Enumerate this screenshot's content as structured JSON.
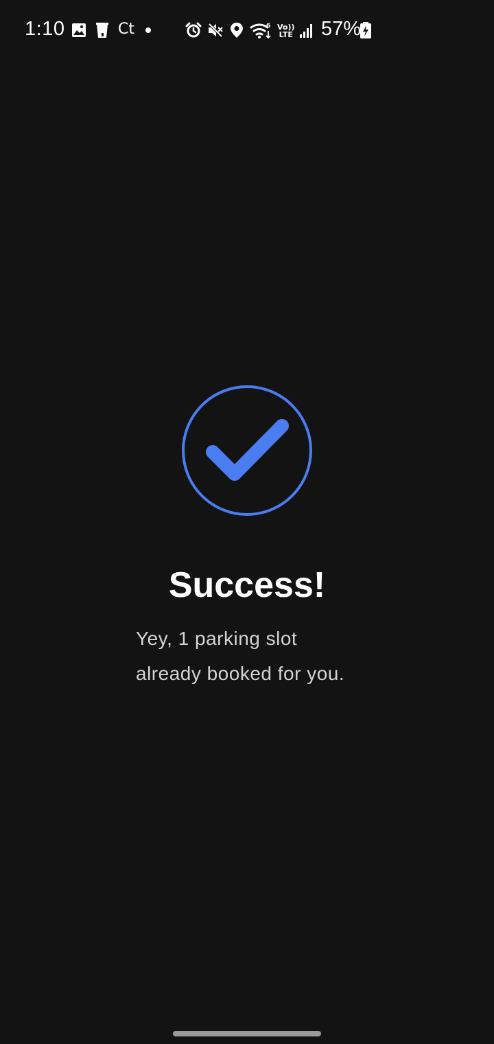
{
  "status_bar": {
    "time": "1:10",
    "carrier_icon_text": "Ct",
    "volte_line1": "Vo))",
    "volte_line2": "LTE",
    "battery_percent": "57%",
    "icons": [
      "gallery-icon",
      "cup-icon",
      "ct-icon",
      "dot-icon",
      "alarm-icon",
      "mute-icon",
      "location-icon",
      "wifi-icon",
      "volte-icon",
      "signal-icon",
      "battery-icon"
    ]
  },
  "success": {
    "title": "Success!",
    "message_line1": "Yey, 1 parking slot",
    "message_line2": "already booked for you.",
    "accent_color": "#4A7CF2"
  },
  "navigation": {
    "home_indicator": "home-indicator"
  }
}
